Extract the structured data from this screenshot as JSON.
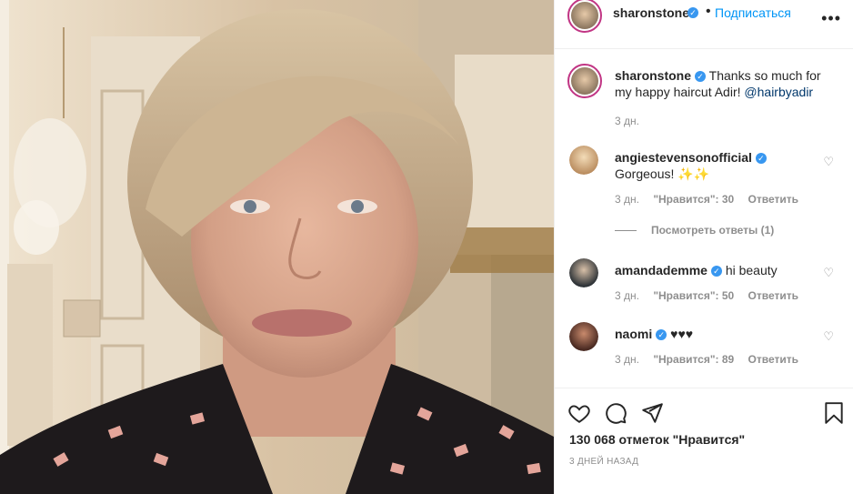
{
  "post": {
    "author": "sharonstone",
    "follow_label": "Подписаться",
    "more_label": "•••"
  },
  "caption": {
    "username": "sharonstone",
    "text": "Thanks so much for my happy haircut Adir! ",
    "mention": "@hairbyadir",
    "time": "3 дн."
  },
  "comments": [
    {
      "username": "angiestevensonofficial",
      "text": "Gorgeous! ✨✨",
      "time": "3 дн.",
      "likes": "\"Нравится\": 30",
      "reply": "Ответить",
      "view_replies": "Посмотреть ответы (1)"
    },
    {
      "username": "amandademme",
      "text": "hi beauty",
      "time": "3 дн.",
      "likes": "\"Нравится\": 50",
      "reply": "Ответить"
    },
    {
      "username": "naomi",
      "text": "♥♥♥",
      "time": "3 дн.",
      "likes": "\"Нравится\": 89",
      "reply": "Ответить"
    }
  ],
  "likes_count": "130 068 отметок \"Нравится\"",
  "date_label": "3 ДНЕЙ НАЗАД",
  "icons": {
    "verified": "verified-badge",
    "like": "heart-icon",
    "comment": "comment-icon",
    "share": "share-icon",
    "save": "bookmark-icon",
    "more": "more-icon"
  },
  "colors": {
    "link": "#0095f6",
    "verified": "#3897f0",
    "muted": "#8e8e8e"
  }
}
